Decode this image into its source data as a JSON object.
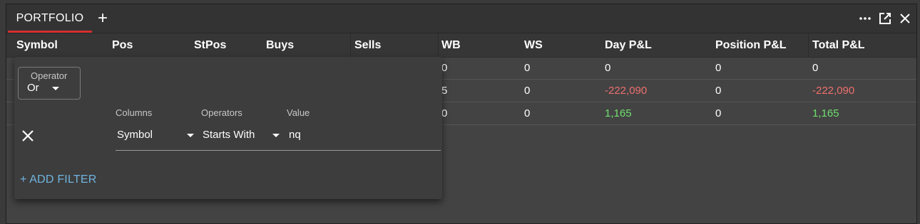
{
  "tab": {
    "label": "PORTFOLIO",
    "add_icon": "+"
  },
  "columns": [
    "Symbol",
    "Pos",
    "StPos",
    "Buys",
    "Sells",
    "WB",
    "WS",
    "Day P&L",
    "Position P&L",
    "Total P&L"
  ],
  "rows": [
    {
      "wb": "0",
      "ws": "0",
      "day_pnl": "0",
      "pos_pnl": "0",
      "total_pnl": "0"
    },
    {
      "wb": "5",
      "ws": "0",
      "day_pnl": "-222,090",
      "pos_pnl": "0",
      "total_pnl": "-222,090"
    },
    {
      "wb": "0",
      "ws": "0",
      "day_pnl": "1,165",
      "pos_pnl": "0",
      "total_pnl": "1,165"
    }
  ],
  "filter": {
    "operator_label": "Operator",
    "operator_value": "Or",
    "columns_label": "Columns",
    "operators_label": "Operators",
    "value_label": "Value",
    "column_value": "Symbol",
    "operator_select_value": "Starts With",
    "value": "nq",
    "add_filter_label": "+ ADD FILTER"
  },
  "colors": {
    "negative": "#ef6f6f",
    "positive": "#6fe06f",
    "accent": "#d32f2f",
    "link": "#70b4e0"
  }
}
